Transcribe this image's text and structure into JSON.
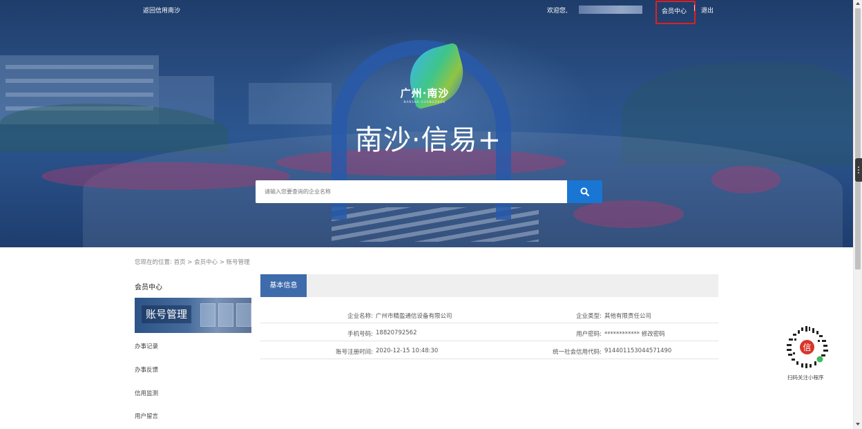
{
  "topbar": {
    "back_label": "返回信用南沙",
    "welcome": "欢迎您,",
    "member_center": "会员中心",
    "separator": "|",
    "logout": "退出"
  },
  "hero": {
    "city_logo_cn": "广州·南沙",
    "city_logo_en": "NANSHA·GUANGZHOU",
    "slogan": "南沙·信易+"
  },
  "search": {
    "placeholder": "请输入您要查询的企业名称",
    "button_icon": "search-icon"
  },
  "breadcrumb": {
    "prefix": "您现在的位置:",
    "items": [
      "首页",
      "会员中心",
      "账号管理"
    ],
    "separator": ">"
  },
  "sidebar": {
    "title": "会员中心",
    "active": "账号管理",
    "items": [
      "办事记录",
      "办事反馈",
      "信用监测",
      "用户留言"
    ]
  },
  "main": {
    "tab": "基本信息",
    "rows": [
      {
        "left_key": "企业名称:",
        "left_val": "广州市精盈通信设备有限公司",
        "right_key": "企业类型:",
        "right_val": "其他有限责任公司"
      },
      {
        "left_key": "手机号码:",
        "left_val": "18820792562",
        "right_key": "用户密码:",
        "right_val": "************",
        "right_link": "修改密码"
      },
      {
        "left_key": "账号注册时间:",
        "left_val": "2020-12-15 10:48:30",
        "right_key": "统一社会信用代码:",
        "right_val": "914401153044571490"
      }
    ]
  },
  "qr": {
    "center_char": "信",
    "caption": "扫码关注小程序"
  },
  "colors": {
    "primary": "#1976d2",
    "tab_active": "#3e6bab",
    "highlight_border": "#e02020"
  }
}
